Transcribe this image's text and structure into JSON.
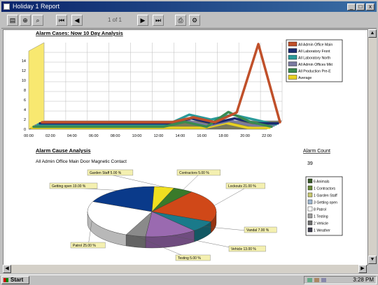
{
  "window": {
    "title": "Holiday 1 Report",
    "min_label": "_",
    "max_label": "□",
    "close_label": "x"
  },
  "toolbar": {
    "page_indicator": "1 of 1",
    "icons": [
      "print-icon",
      "zoom-icon",
      "search-icon",
      "first-page-icon",
      "prev-page-icon",
      "next-page-icon",
      "last-page-icon",
      "export-icon",
      "setup-icon"
    ]
  },
  "line_section": {
    "title": "Alarm Cases: Now 10 Day Analysis",
    "legend": [
      {
        "label": "All Admin Office Main",
        "color": "#c0502a"
      },
      {
        "label": "All Laboratory Front",
        "color": "#1a2a70"
      },
      {
        "label": "All Laboratory North",
        "color": "#2a9a9a"
      },
      {
        "label": "All Admin Offices Mkt",
        "color": "#7a7aa0"
      },
      {
        "label": "All Production Pre-E",
        "color": "#3a8a50"
      },
      {
        "label": "Average",
        "color": "#e8d020"
      }
    ]
  },
  "chart_data": {
    "type": "line",
    "x": [
      "00:00",
      "02:00",
      "04:00",
      "06:00",
      "08:00",
      "10:00",
      "12:00",
      "14:00",
      "16:00",
      "18:00",
      "20:00",
      "22:00"
    ],
    "ylim": [
      0,
      16
    ],
    "yticks": [
      "0",
      "2",
      "4",
      "6",
      "8",
      "10",
      "12",
      "14"
    ],
    "series": [
      {
        "name": "All Admin Office Main",
        "values": [
          0,
          0,
          0,
          0,
          0,
          0,
          0,
          1,
          0,
          2,
          16,
          0
        ]
      },
      {
        "name": "All Laboratory Front",
        "values": [
          0,
          0,
          0,
          0,
          0,
          0,
          0,
          1,
          0,
          1,
          0,
          0
        ]
      },
      {
        "name": "All Laboratory North",
        "values": [
          0,
          0,
          0,
          0,
          0,
          0,
          0,
          2,
          1,
          2,
          1,
          0
        ]
      },
      {
        "name": "All Admin Offices Mkt",
        "values": [
          0,
          0,
          0,
          0,
          0,
          0,
          0,
          1,
          0,
          1,
          0,
          0
        ]
      },
      {
        "name": "All Production Pre-E",
        "values": [
          0,
          0,
          0,
          0,
          0,
          0,
          0,
          1,
          0,
          3,
          1,
          0
        ]
      },
      {
        "name": "Average",
        "values": [
          0,
          0,
          0,
          0,
          0,
          0,
          0,
          0,
          0,
          1,
          0,
          0
        ]
      }
    ]
  },
  "pie_section": {
    "title": "Alarm Cause Analysis",
    "subtitle": "All Admin Office Main Door Magnetic Contact",
    "alarm_count_label": "Alarm Count",
    "alarm_count_value": "39",
    "slices": [
      {
        "label": "Contractors 5.00 %",
        "color": "#3a7a2a"
      },
      {
        "label": "Lockouts 21.00 %",
        "color": "#d04818"
      },
      {
        "label": "Vandal 7.00 %",
        "color": "#1a7a8a"
      },
      {
        "label": "Vehicle 13.00 %",
        "color": "#9a6ab0"
      },
      {
        "label": "Testing 5.00 %",
        "color": "#8a8a8a"
      },
      {
        "label": "Patrol 25.00 %",
        "color": "#ffffff"
      },
      {
        "label": "Getting open 19.00 %",
        "color": "#0a3a8a"
      },
      {
        "label": "Garden Staff 5.00 %",
        "color": "#f0e020"
      }
    ],
    "legend": [
      {
        "label": "6 Animals",
        "color": "#3a5a2a"
      },
      {
        "label": "1 Contractors",
        "color": "#6a8a3a"
      },
      {
        "label": "1 Garden Staff",
        "color": "#c8c870"
      },
      {
        "label": "3 Getting open",
        "color": "#a0b8d0"
      },
      {
        "label": "8 Patrol",
        "color": "#ffffff"
      },
      {
        "label": "1 Testing",
        "color": "#a0a0a0"
      },
      {
        "label": "2 Vehicle",
        "color": "#707070"
      },
      {
        "label": "1 Weather",
        "color": "#404050"
      }
    ]
  },
  "taskbar": {
    "start_label": "Start",
    "clock": "3:28 PM"
  }
}
